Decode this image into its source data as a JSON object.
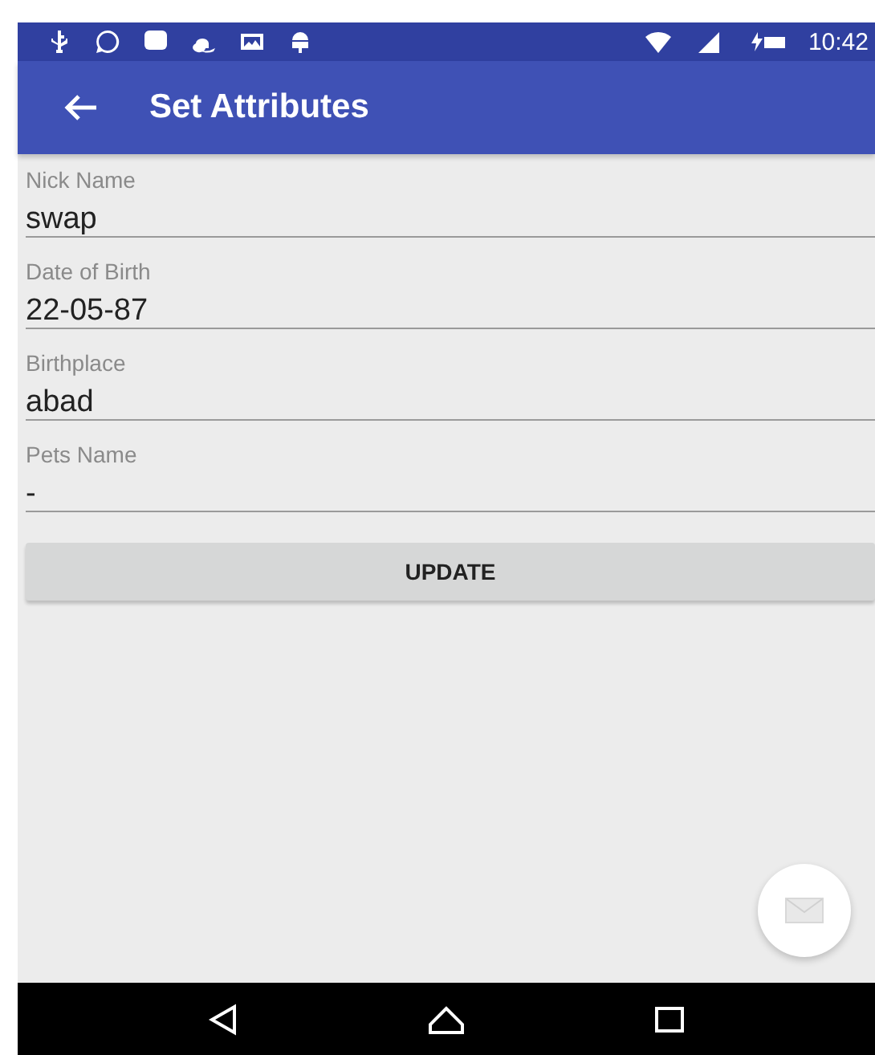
{
  "status_bar": {
    "time": "10:42"
  },
  "app_bar": {
    "title": "Set Attributes"
  },
  "fields": [
    {
      "label": "Nick Name",
      "value": "swap"
    },
    {
      "label": "Date of Birth",
      "value": "22-05-87"
    },
    {
      "label": "Birthplace",
      "value": "abad"
    },
    {
      "label": "Pets Name",
      "value": "-"
    }
  ],
  "button": {
    "label": "UPDATE"
  }
}
